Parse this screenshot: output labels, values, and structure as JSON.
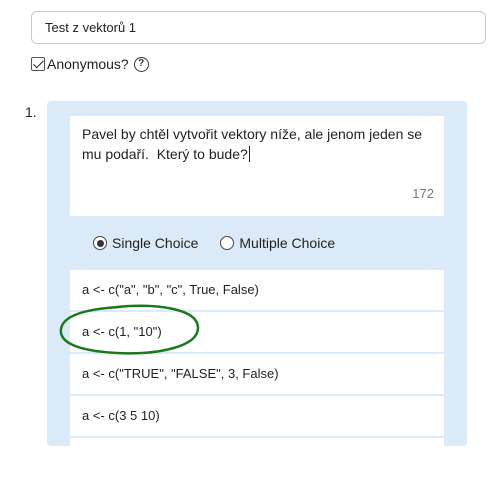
{
  "quiz": {
    "title_value": "Test z vektorů 1",
    "anonymous_label": "Anonymous?",
    "help_glyph": "?"
  },
  "question": {
    "number": "1.",
    "prompt": "Pavel by chtěl vytvořit vektory níže, ale jenom jeden se mu podaří.  Který to bude?",
    "char_count": "172",
    "types": [
      {
        "label": "Single Choice",
        "selected": true
      },
      {
        "label": "Multiple Choice",
        "selected": false
      }
    ],
    "options": [
      "a <- c(\"a\", \"b\", \"c\", True, False)",
      "a <- c(1, \"10\")",
      "a <- c(\"TRUE\", \"FALSE\", 3, False)",
      "a <- c(3 5 10)",
      ""
    ]
  },
  "colors": {
    "panel_bg": "#dbeaf8",
    "annotation_circle": "#1a7a1a"
  }
}
